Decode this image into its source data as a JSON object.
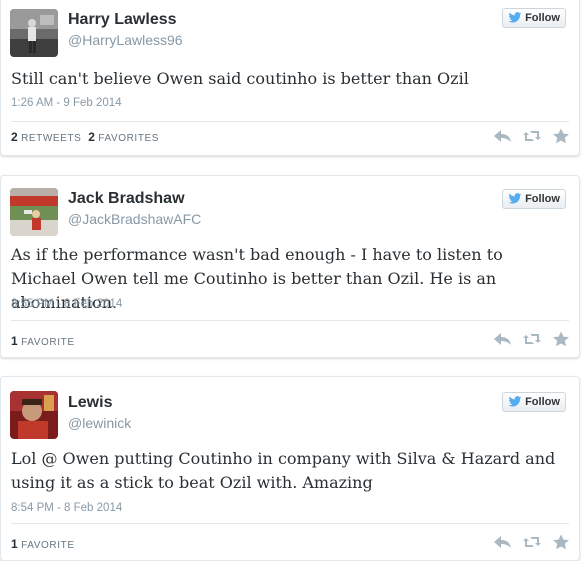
{
  "tweets": [
    {
      "name": "Harry Lawless",
      "handle": "@HarryLawless96",
      "follow_label": "Follow",
      "text": "Still can't believe Owen said coutinho is better than Ozil",
      "timestamp": "1:26 AM - 9 Feb 2014",
      "retweets_count": "2",
      "retweets_label": "RETWEETS",
      "favorites_count": "2",
      "favorites_label": "FAVORITES"
    },
    {
      "name": "Jack Bradshaw",
      "handle": "@JackBradshawAFC",
      "follow_label": "Follow",
      "text": "As if the performance wasn't bad enough - I have to listen to Michael Owen tell me Coutinho is better than Ozil. He is an abomination.",
      "timestamp": "8:55 PM - 8 Feb 2014",
      "favorites_count": "1",
      "favorites_label": "FAVORITE"
    },
    {
      "name": "Lewis",
      "handle": "@lewinick",
      "follow_label": "Follow",
      "text": "Lol @ Owen putting Coutinho in company with Silva & Hazard and using it as a stick to beat Ozil with. Amazing",
      "timestamp": "8:54 PM - 8 Feb 2014",
      "favorites_count": "1",
      "favorites_label": "FAVORITE"
    }
  ],
  "icons": {
    "bird": "twitter-bird-icon",
    "reply": "reply-icon",
    "retweet": "retweet-icon",
    "favorite": "star-icon"
  },
  "colors": {
    "bird": "#55acee",
    "action_icons": "#aab8c2",
    "meta_text": "#8899a6"
  }
}
